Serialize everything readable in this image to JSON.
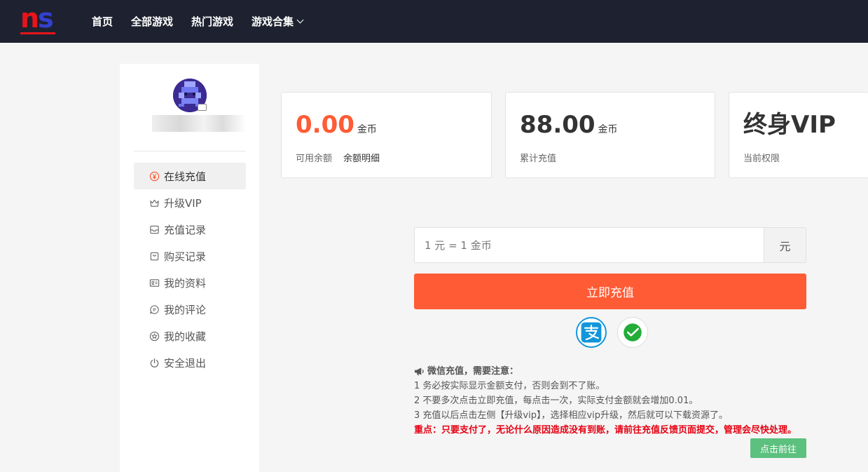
{
  "header": {
    "logo_text": "ns",
    "nav": [
      {
        "label": "首页"
      },
      {
        "label": "全部游戏"
      },
      {
        "label": "热门游戏"
      },
      {
        "label": "游戏合集"
      }
    ]
  },
  "sidebar": {
    "menu": [
      {
        "label": "在线充值",
        "icon": "yen-circle-icon",
        "active": true
      },
      {
        "label": "升级VIP",
        "icon": "crown-icon"
      },
      {
        "label": "充值记录",
        "icon": "inbox-icon"
      },
      {
        "label": "购买记录",
        "icon": "shopping-bag-icon"
      },
      {
        "label": "我的资料",
        "icon": "id-card-icon"
      },
      {
        "label": "我的评论",
        "icon": "comment-icon"
      },
      {
        "label": "我的收藏",
        "icon": "star-circle-icon"
      },
      {
        "label": "安全退出",
        "icon": "power-icon"
      }
    ]
  },
  "stats": {
    "balance": {
      "value": "0.00",
      "unit": "金币",
      "label": "可用余额",
      "link": "余额明细"
    },
    "total": {
      "value": "88.00",
      "unit": "金币",
      "label": "累计充值"
    },
    "vip": {
      "value": "终身VIP",
      "label": "当前权限"
    }
  },
  "recharge": {
    "placeholder": "1 元 = 1 金币",
    "suffix": "元",
    "button": "立即充值",
    "methods": [
      "alipay-icon",
      "wechat-pay-icon"
    ]
  },
  "notice": {
    "title": "微信充值，需要注意：",
    "lines": [
      "1 务必按实际显示金额支付，否则会到不了账。",
      "2 不要多次点击立即充值，每点击一次，实际支付金额就会增加0.01。",
      "3 充值以后点击左侧【升级vip】，选择相应vip升级，然后就可以下载资源了。"
    ],
    "important": "重点：只要支付了，无论什么原因造成没有到账，请前往充值反馈页面提交，管理会尽快处理。",
    "goto_button": "点击前往"
  },
  "colors": {
    "header_bg": "#1e2230",
    "accent": "#ff5b35",
    "important": "#e60012",
    "goto": "#5cc07e"
  }
}
